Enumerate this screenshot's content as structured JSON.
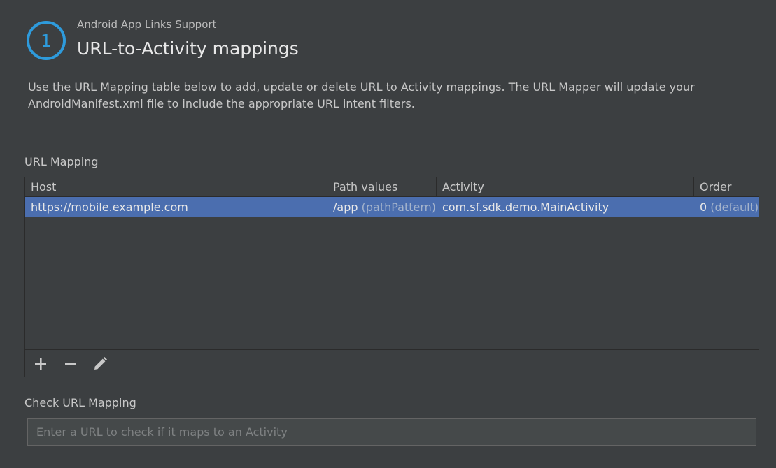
{
  "header": {
    "step_number": "1",
    "subtitle": "Android App Links Support",
    "title": "URL-to-Activity mappings"
  },
  "description": "Use the URL Mapping table below to add, update or delete URL to Activity mappings. The URL Mapper will update your AndroidManifest.xml file to include the appropriate URL intent filters.",
  "url_mapping": {
    "label": "URL Mapping",
    "columns": [
      "Host",
      "Path values",
      "Activity",
      "Order"
    ],
    "rows": [
      {
        "host": "https://mobile.example.com",
        "path_value": "/app",
        "path_type": "(pathPattern)",
        "activity": "com.sf.sdk.demo.MainActivity",
        "order": "0",
        "order_note": "(default)"
      }
    ],
    "toolbar": {
      "add_icon": "plus-icon",
      "remove_icon": "minus-icon",
      "edit_icon": "pencil-icon"
    }
  },
  "check_mapping": {
    "label": "Check URL Mapping",
    "placeholder": "Enter a URL to check if it maps to an Activity",
    "value": ""
  },
  "colors": {
    "background": "#3c3f41",
    "accent": "#2e9bdc",
    "selection": "#4b6eaf"
  }
}
